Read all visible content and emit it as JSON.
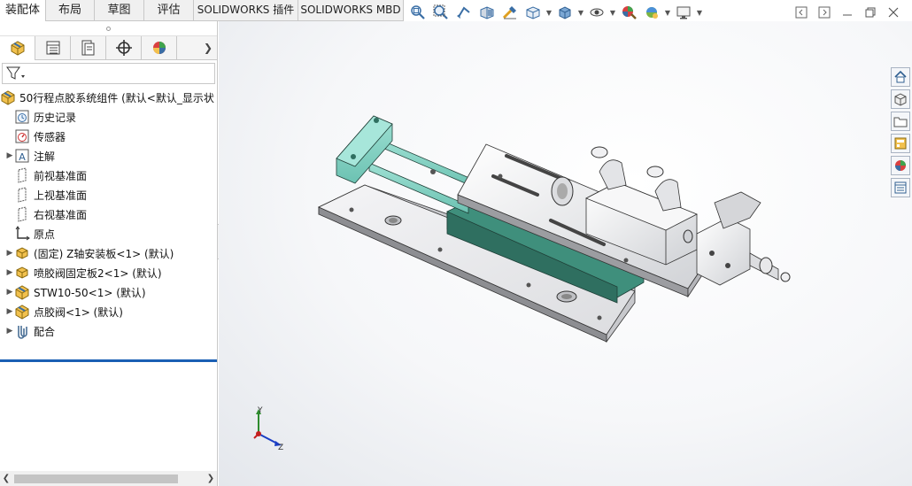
{
  "tabs": [
    {
      "label": "装配体",
      "active": true
    },
    {
      "label": "布局"
    },
    {
      "label": "草图"
    },
    {
      "label": "评估"
    },
    {
      "label": "SOLIDWORKS 插件"
    },
    {
      "label": "SOLIDWORKS MBD"
    }
  ],
  "hud_icons": [
    "zoom-to-fit-icon",
    "zoom-to-area-icon",
    "previous-view-icon",
    "section-view-icon",
    "dynamic-annotation-icon",
    "view-orientation-icon",
    "display-style-icon",
    "hide-show-items-icon",
    "edit-appearance-icon",
    "apply-scene-icon",
    "view-settings-icon"
  ],
  "manager_tabs": [
    "featuremanager-icon",
    "propertymanager-icon",
    "configurationmanager-icon",
    "dimxpert-icon",
    "displaymanager-icon"
  ],
  "tree": {
    "root": "50行程点胶系统组件  (默认<默认_显示状",
    "items": [
      {
        "label": "历史记录",
        "icon": "history-icon",
        "expandable": false
      },
      {
        "label": "传感器",
        "icon": "sensor-icon",
        "expandable": false
      },
      {
        "label": "注解",
        "icon": "annotation-icon",
        "expandable": true
      },
      {
        "label": "前视基准面",
        "icon": "plane-icon",
        "expandable": false
      },
      {
        "label": "上视基准面",
        "icon": "plane-icon",
        "expandable": false
      },
      {
        "label": "右视基准面",
        "icon": "plane-icon",
        "expandable": false
      },
      {
        "label": "原点",
        "icon": "origin-icon",
        "expandable": false
      },
      {
        "label": "(固定) Z轴安装板<1> (默认)",
        "icon": "part-icon",
        "expandable": true
      },
      {
        "label": "喷胶阀固定板2<1> (默认)",
        "icon": "part-icon",
        "expandable": true
      },
      {
        "label": "STW10-50<1> (默认)",
        "icon": "subassembly-icon",
        "expandable": true
      },
      {
        "label": "点胶阀<1> (默认)",
        "icon": "subassembly-icon",
        "expandable": true
      },
      {
        "label": "配合",
        "icon": "mates-icon",
        "expandable": true
      }
    ]
  },
  "triad": {
    "y": "Y",
    "z": "Z"
  },
  "task_pane": [
    "home-icon",
    "design-library-icon",
    "file-explorer-icon",
    "view-palette-icon",
    "appearances-icon",
    "custom-properties-icon"
  ],
  "colors": {
    "accent": "#1a5fb4",
    "plate": "#e8e8ea",
    "teal": "#7fcfc1",
    "dark_teal": "#3f8f7c"
  }
}
